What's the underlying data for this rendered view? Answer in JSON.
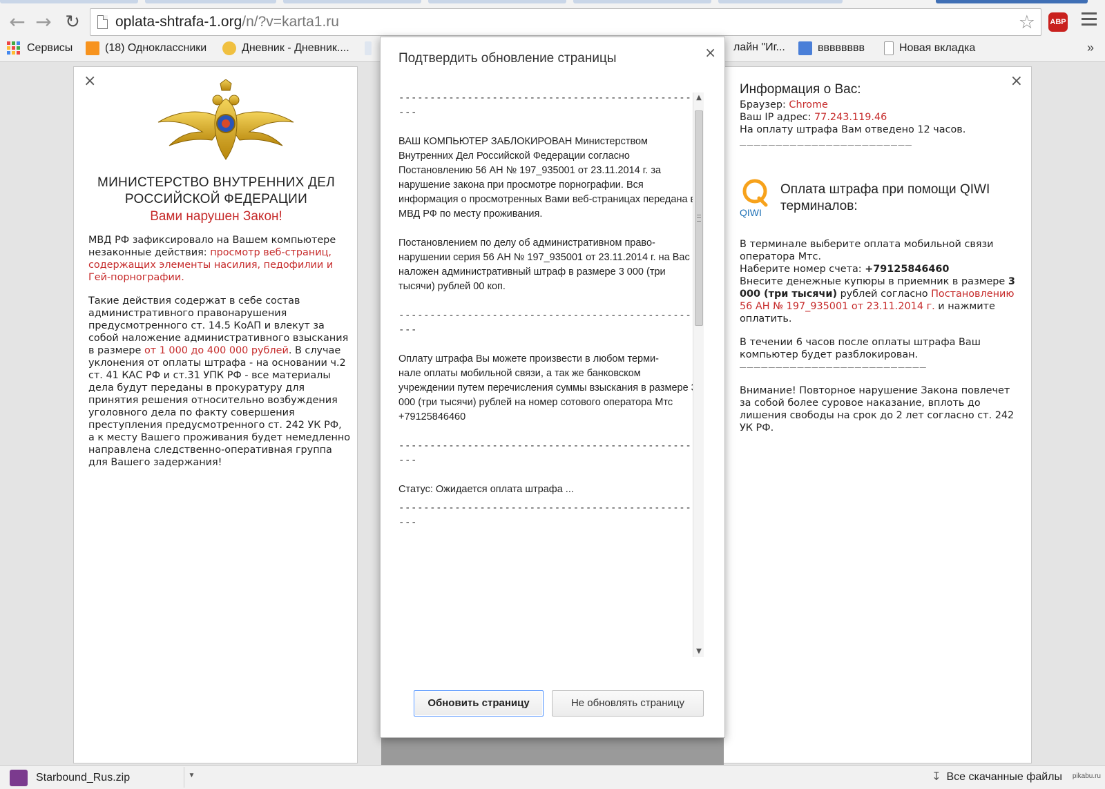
{
  "browser": {
    "url_host": "oplata-shtrafa-1.org",
    "url_rest": "/n/?v=karta1.ru",
    "icons": {
      "back": "back-arrow-icon",
      "forward": "forward-arrow-icon",
      "reload": "reload-icon",
      "star": "bookmark-star-icon",
      "abp": "adblock-plus-icon",
      "menu": "hamburger-menu-icon"
    },
    "abp_label": "ABP",
    "bookmarks": [
      {
        "label": "Сервисы"
      },
      {
        "label": "(18) Одноклассники"
      },
      {
        "label": "Дневник - Дневник...."
      },
      {
        "label": "лайн \"Иг..."
      },
      {
        "label": "вввввввв"
      },
      {
        "label": "Новая вкладка"
      }
    ],
    "bookmarks_overflow": "»"
  },
  "left_panel": {
    "title": "МИНИСТЕРСТВО ВНУТРЕННИХ ДЕЛ РОССИЙСКОЙ ФЕДЕРАЦИИ",
    "warning": "Вами нарушен Закон!",
    "p1_a": "МВД РФ зафиксировало на Вашем компьютере незаконные действия: ",
    "p1_red": "просмотр веб-страниц, содержащих элементы насилия, педофилии и Гей-порнографии.",
    "p2_a": "Такие действия содержат в себе состав административного правонарушения предусмотренного ст. 14.5 КоАП и влекут за собой наложение административного взыскания в размере ",
    "p2_red": "от 1 000 до 400 000 рублей",
    "p2_b": ". В случае уклонения от оплаты штрафа - на основании ч.2 ст. 41 КАС РФ и ст.31 УПК РФ - все материалы дела будут переданы в прокуратуру для принятия решения относительно возбуждения уголовного дела по факту совершения преступления предусмотренного ст. 242 УК РФ, а к месту Вашего проживания будет немедленно направлена следственно-оперативная группа для Вашего задержания!"
  },
  "right_panel": {
    "info_title": "Информация о Вас:",
    "browser_label": "Браузер: ",
    "browser_value": "Chrome",
    "ip_label": "Ваш IP адрес: ",
    "ip_value": "77.243.119.46",
    "time_notice": "На оплату штрафа Вам отведено 12 часов.",
    "dash_line": "________________________",
    "qiwi_logo_text": "QIWI",
    "qiwi_title": "Оплата штрафа при помощи QIWI терминалов:",
    "step1": "В терминале выберите оплата мобильной связи оператора Мтс.",
    "step2_label": "Наберите номер счета: ",
    "step2_value": "+79125846460",
    "step3_a": "Внесите денежные купюры в приемник в размере ",
    "step3_bold": "3 000 (три тысячи)",
    "step3_b": " рублей согласно ",
    "step3_red": "Постановлению 56 АН № 197_935001 от 23.11.2014 г.",
    "step3_c": " и нажмите оплатить.",
    "unlock_note": "В течении 6 часов после оплаты штрафа Ваш компьютер будет разблокирован.",
    "dash_line2": "__________________________",
    "attention": "Внимание! Повторное нарушение Закона повлечет за собой более суровое наказание, вплоть до лишения свободы на срок до 2 лет согласно ст. 242 УК РФ."
  },
  "dialog": {
    "title": "Подтвердить обновление страницы",
    "close": "×",
    "dashes": "--------------------------------------------------",
    "msg1": "ВАШ КОМПЬЮТЕР ЗАБЛОКИРОВАН Министерством Внутренних Дел Российской Федерации согласно Постановлению 56 АН № 197_935001 от 23.11.2014 г. за нарушение закона при просмотре порнографии. Вся информация о просмотренных Вами веб-страницах передана в МВД РФ по месту проживания.",
    "msg2": "Постановлением по делу об административном право-\nнарушении серия 56 АН № 197_935001 от 23.11.2014 г. на Вас наложен административный штраф в размере 3 000 (три тысячи) рублей 00 коп.",
    "msg3": "Оплату штрафа Вы можете произвести в любом терми-\nнале оплаты мобильной связи, а так же банковском учреждении путем перечисления суммы взыскания в размере 3 000 (три тысячи) рублей на номер сотового оператора Мтс +79125846460",
    "status": "Статус: Ожидается оплата штрафа ...",
    "btn_reload": "Обновить страницу",
    "btn_stay": "Не обновлять страницу"
  },
  "shelf": {
    "download_name": "Starbound_Rus.zip",
    "all_downloads": "Все скачанные файлы",
    "watermark": "pikabu.ru"
  },
  "colors": {
    "warning_red": "#c62b2b",
    "primary_focus": "#4d90fe"
  }
}
